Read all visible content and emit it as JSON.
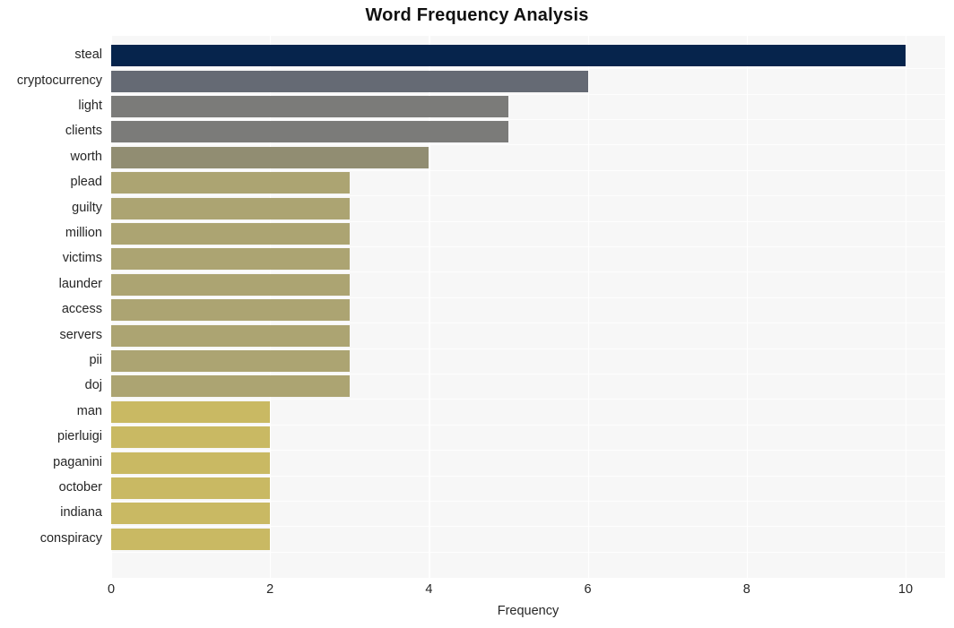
{
  "chart_data": {
    "type": "bar",
    "orientation": "horizontal",
    "title": "Word Frequency Analysis",
    "xlabel": "Frequency",
    "ylabel": "",
    "categories": [
      "steal",
      "cryptocurrency",
      "light",
      "clients",
      "worth",
      "plead",
      "guilty",
      "million",
      "victims",
      "launder",
      "access",
      "servers",
      "pii",
      "doj",
      "man",
      "pierluigi",
      "paganini",
      "october",
      "indiana",
      "conspiracy"
    ],
    "values": [
      10,
      6,
      5,
      5,
      4,
      3,
      3,
      3,
      3,
      3,
      3,
      3,
      3,
      3,
      2,
      2,
      2,
      2,
      2,
      2
    ],
    "bar_colors": [
      "#06244c",
      "#656a74",
      "#7b7b79",
      "#7b7b79",
      "#918d72",
      "#aca472",
      "#aca472",
      "#aca472",
      "#aca472",
      "#aca472",
      "#aca472",
      "#aca472",
      "#aca472",
      "#aca472",
      "#c9b963",
      "#c9b963",
      "#c9b963",
      "#c9b963",
      "#c9b963",
      "#c9b963"
    ],
    "xlim": [
      0,
      10.5
    ],
    "xticks": [
      0,
      2,
      4,
      6,
      8,
      10
    ],
    "xtick_labels": [
      "0",
      "2",
      "4",
      "6",
      "8",
      "10"
    ],
    "grid": true,
    "grid_color": "#ffffff",
    "plot_background": "#f7f7f7",
    "figure_background": "#ffffff",
    "legend": null
  }
}
